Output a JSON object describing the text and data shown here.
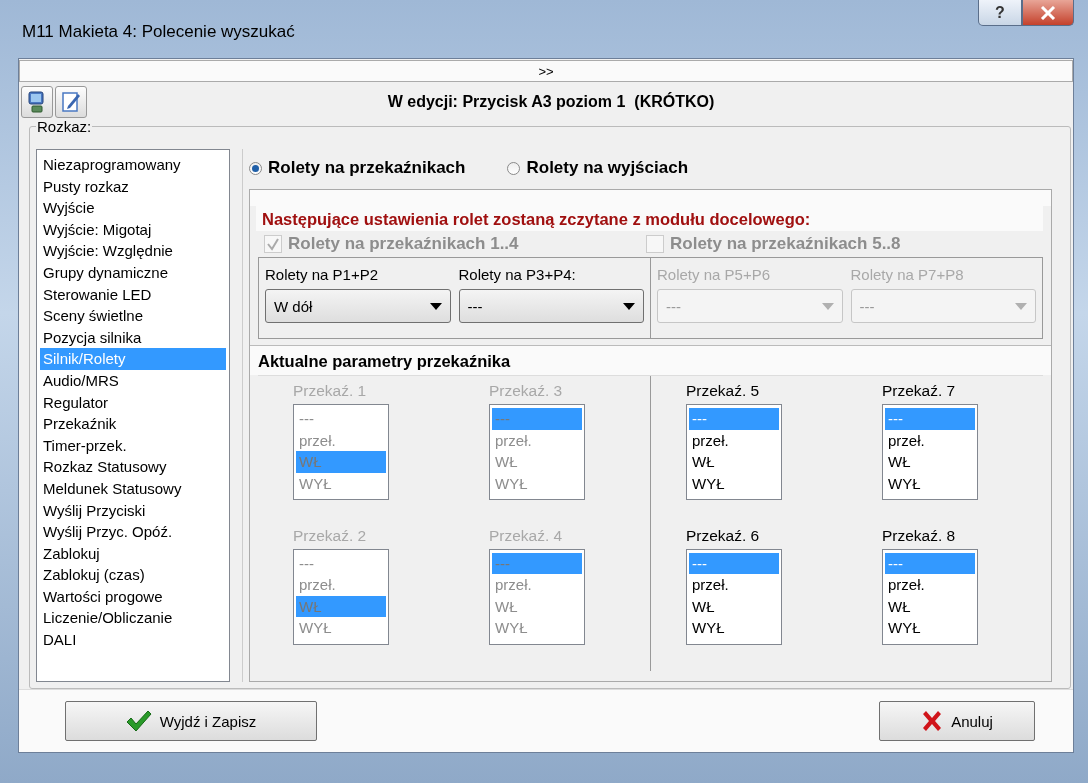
{
  "window": {
    "title": "M11 Makieta 4: Polecenie wyszukać",
    "help": "?"
  },
  "expander": ">>",
  "editing_title": "W edycji: Przycisk A3 poziom 1  (KRÓTKO)",
  "command_group": {
    "label": "Rozkaz:",
    "items": [
      {
        "label": "Niezaprogramowany",
        "selected": false
      },
      {
        "label": "Pusty rozkaz",
        "selected": false
      },
      {
        "label": "Wyjście",
        "selected": false
      },
      {
        "label": "Wyjście: Migotaj",
        "selected": false
      },
      {
        "label": "Wyjście: Względnie",
        "selected": false
      },
      {
        "label": "Grupy dynamiczne",
        "selected": false
      },
      {
        "label": "Sterowanie LED",
        "selected": false
      },
      {
        "label": "Sceny świetlne",
        "selected": false
      },
      {
        "label": "Pozycja silnika",
        "selected": false
      },
      {
        "label": "Silnik/Rolety",
        "selected": true
      },
      {
        "label": "Audio/MRS",
        "selected": false
      },
      {
        "label": "Regulator",
        "selected": false
      },
      {
        "label": "Przekaźnik",
        "selected": false
      },
      {
        "label": "Timer-przek.",
        "selected": false
      },
      {
        "label": "Rozkaz Statusowy",
        "selected": false
      },
      {
        "label": "Meldunek Statusowy",
        "selected": false
      },
      {
        "label": "Wyślij Przyciski",
        "selected": false
      },
      {
        "label": "Wyślij Przyc. Opóź.",
        "selected": false
      },
      {
        "label": "Zablokuj",
        "selected": false
      },
      {
        "label": "Zablokuj (czas)",
        "selected": false
      },
      {
        "label": "Wartości progowe",
        "selected": false
      },
      {
        "label": "Liczenie/Obliczanie",
        "selected": false
      },
      {
        "label": "DALI",
        "selected": false
      }
    ]
  },
  "mode_options": [
    {
      "label": "Rolety na przekaźnikach",
      "selected": true
    },
    {
      "label": "Rolety na wyjściach",
      "selected": false
    }
  ],
  "notice": "Następujące ustawienia rolet zostaną zczytane z modułu docelowego:",
  "relay_groups": [
    {
      "label": "Rolety na przekaźnikach 1..4",
      "checked": true,
      "disabled": true,
      "blinds": [
        {
          "label": "Rolety na P1+P2",
          "value": "W dół",
          "disabled": false
        },
        {
          "label": "Rolety na P3+P4:",
          "value": "---",
          "disabled": false
        }
      ]
    },
    {
      "label": "Rolety na przekaźnikach 5..8",
      "checked": false,
      "disabled": true,
      "blinds": [
        {
          "label": "Rolety na P5+P6",
          "value": "---",
          "disabled": true
        },
        {
          "label": "Rolety na P7+P8",
          "value": "---",
          "disabled": true
        }
      ]
    }
  ],
  "params_title": "Aktualne parametry przekaźnika",
  "relay_panels": [
    {
      "relays": [
        {
          "label": "Przekaź. 1",
          "disabled": true,
          "options": [
            {
              "label": "---",
              "selected": false
            },
            {
              "label": "przeł.",
              "selected": false
            },
            {
              "label": "WŁ",
              "selected": true
            },
            {
              "label": "WYŁ",
              "selected": false
            }
          ]
        },
        {
          "label": "Przekaź. 3",
          "disabled": true,
          "options": [
            {
              "label": "---",
              "selected": true
            },
            {
              "label": "przeł.",
              "selected": false
            },
            {
              "label": "WŁ",
              "selected": false
            },
            {
              "label": "WYŁ",
              "selected": false
            }
          ]
        },
        {
          "label": "Przekaź. 2",
          "disabled": true,
          "options": [
            {
              "label": "---",
              "selected": false
            },
            {
              "label": "przeł.",
              "selected": false
            },
            {
              "label": "WŁ",
              "selected": true
            },
            {
              "label": "WYŁ",
              "selected": false
            }
          ]
        },
        {
          "label": "Przekaź. 4",
          "disabled": true,
          "options": [
            {
              "label": "---",
              "selected": true
            },
            {
              "label": "przeł.",
              "selected": false
            },
            {
              "label": "WŁ",
              "selected": false
            },
            {
              "label": "WYŁ",
              "selected": false
            }
          ]
        }
      ]
    },
    {
      "relays": [
        {
          "label": "Przekaź. 5",
          "disabled": false,
          "options": [
            {
              "label": "---",
              "selected": true
            },
            {
              "label": "przeł.",
              "selected": false
            },
            {
              "label": "WŁ",
              "selected": false
            },
            {
              "label": "WYŁ",
              "selected": false
            }
          ]
        },
        {
          "label": "Przekaź. 7",
          "disabled": false,
          "options": [
            {
              "label": "---",
              "selected": true
            },
            {
              "label": "przeł.",
              "selected": false
            },
            {
              "label": "WŁ",
              "selected": false
            },
            {
              "label": "WYŁ",
              "selected": false
            }
          ]
        },
        {
          "label": "Przekaź. 6",
          "disabled": false,
          "options": [
            {
              "label": "---",
              "selected": true
            },
            {
              "label": "przeł.",
              "selected": false
            },
            {
              "label": "WŁ",
              "selected": false
            },
            {
              "label": "WYŁ",
              "selected": false
            }
          ]
        },
        {
          "label": "Przekaź. 8",
          "disabled": false,
          "options": [
            {
              "label": "---",
              "selected": true
            },
            {
              "label": "przeł.",
              "selected": false
            },
            {
              "label": "WŁ",
              "selected": false
            },
            {
              "label": "WYŁ",
              "selected": false
            }
          ]
        }
      ]
    }
  ],
  "buttons": [
    {
      "label": "Wyjdź i Zapisz",
      "kind": "save"
    },
    {
      "label": "Anuluj",
      "kind": "cancel"
    }
  ]
}
